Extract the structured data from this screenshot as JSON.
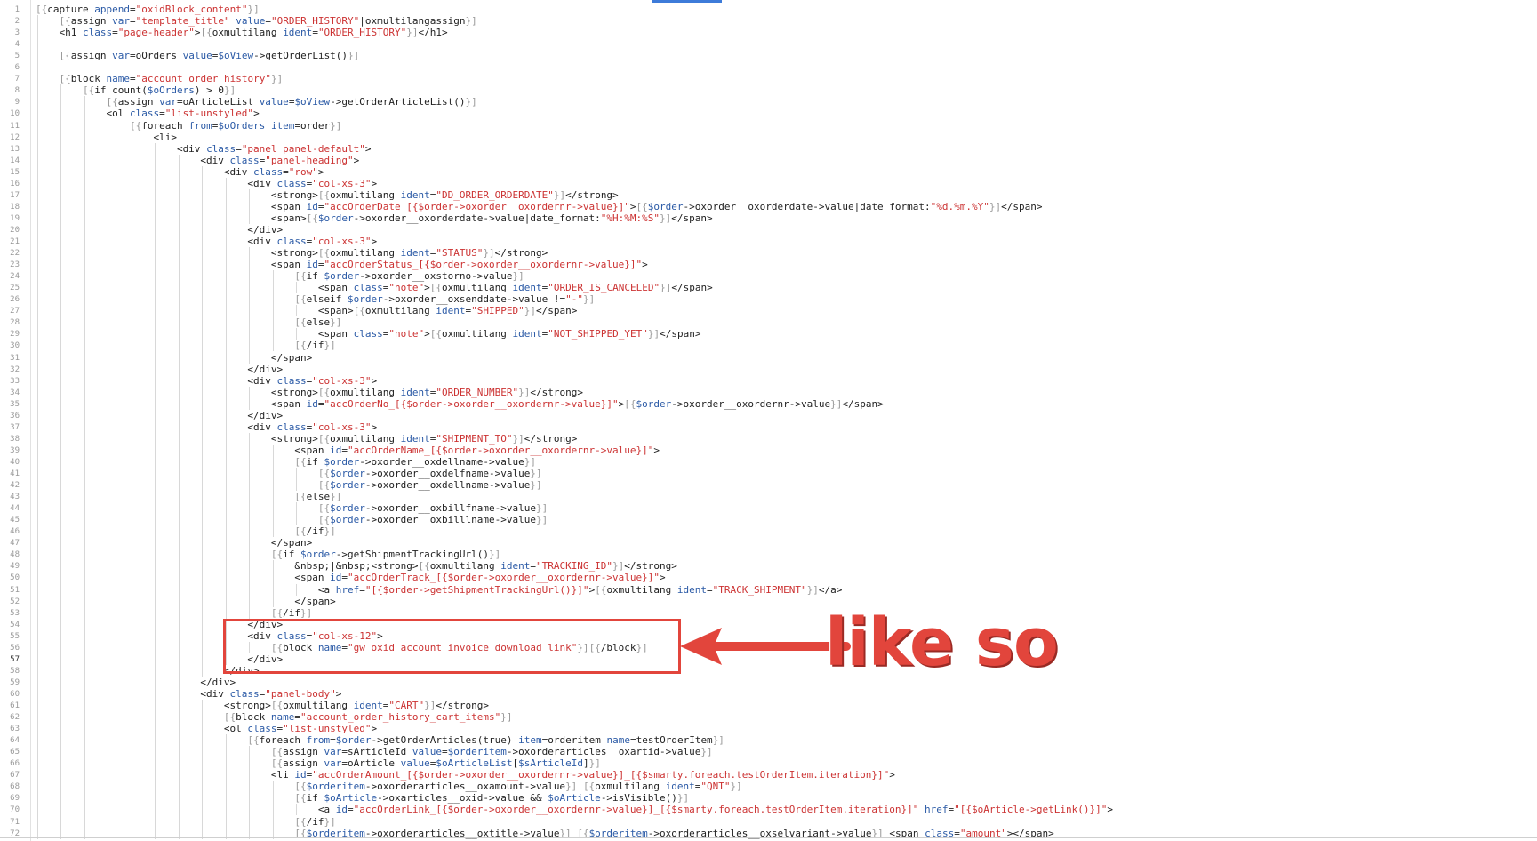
{
  "editor": {
    "lines": [
      "[{capture append=\"oxidBlock_content\"}]",
      "    [{assign var=\"template_title\" value=\"ORDER_HISTORY\"|oxmultilangassign}]",
      "    <h1 class=\"page-header\">[{oxmultilang ident=\"ORDER_HISTORY\"}]</h1>",
      "",
      "    [{assign var=oOrders value=$oView->getOrderList()}]",
      "",
      "    [{block name=\"account_order_history\"}]",
      "        [{if count($oOrders) > 0}]",
      "            [{assign var=oArticleList value=$oView->getOrderArticleList()}]",
      "            <ol class=\"list-unstyled\">",
      "                [{foreach from=$oOrders item=order}]",
      "                    <li>",
      "                        <div class=\"panel panel-default\">",
      "                            <div class=\"panel-heading\">",
      "                                <div class=\"row\">",
      "                                    <div class=\"col-xs-3\">",
      "                                        <strong>[{oxmultilang ident=\"DD_ORDER_ORDERDATE\"}]</strong>",
      "                                        <span id=\"accOrderDate_[{$order->oxorder__oxordernr->value}]\">[{$order->oxorder__oxorderdate->value|date_format:\"%d.%m.%Y\"}]</span>",
      "                                        <span>[{$order->oxorder__oxorderdate->value|date_format:\"%H:%M:%S\"}]</span>",
      "                                    </div>",
      "                                    <div class=\"col-xs-3\">",
      "                                        <strong>[{oxmultilang ident=\"STATUS\"}]</strong>",
      "                                        <span id=\"accOrderStatus_[{$order->oxorder__oxordernr->value}]\">",
      "                                            [{if $order->oxorder__oxstorno->value}]",
      "                                                <span class=\"note\">[{oxmultilang ident=\"ORDER_IS_CANCELED\"}]</span>",
      "                                            [{elseif $order->oxorder__oxsenddate->value !=\"-\"}]",
      "                                                <span>[{oxmultilang ident=\"SHIPPED\"}]</span>",
      "                                            [{else}]",
      "                                                <span class=\"note\">[{oxmultilang ident=\"NOT_SHIPPED_YET\"}]</span>",
      "                                            [{/if}]",
      "                                        </span>",
      "                                    </div>",
      "                                    <div class=\"col-xs-3\">",
      "                                        <strong>[{oxmultilang ident=\"ORDER_NUMBER\"}]</strong>",
      "                                        <span id=\"accOrderNo_[{$order->oxorder__oxordernr->value}]\">[{$order->oxorder__oxordernr->value}]</span>",
      "                                    </div>",
      "                                    <div class=\"col-xs-3\">",
      "                                        <strong>[{oxmultilang ident=\"SHIPMENT_TO\"}]</strong>",
      "                                            <span id=\"accOrderName_[{$order->oxorder__oxordernr->value}]\">",
      "                                            [{if $order->oxorder__oxdellname->value}]",
      "                                                [{$order->oxorder__oxdelfname->value}]",
      "                                                [{$order->oxorder__oxdellname->value}]",
      "                                            [{else}]",
      "                                                [{$order->oxorder__oxbillfname->value}]",
      "                                                [{$order->oxorder__oxbilllname->value}]",
      "                                            [{/if}]",
      "                                        </span>",
      "                                        [{if $order->getShipmentTrackingUrl()}]",
      "                                            &nbsp;|&nbsp;<strong>[{oxmultilang ident=\"TRACKING_ID\"}]</strong>",
      "                                            <span id=\"accOrderTrack_[{$order->oxorder__oxordernr->value}]\">",
      "                                                <a href=\"[{$order->getShipmentTrackingUrl()}]\">[{oxmultilang ident=\"TRACK_SHIPMENT\"}]</a>",
      "                                            </span>",
      "                                        [{/if}]",
      "                                    </div>",
      "                                    <div class=\"col-xs-12\">",
      "                                        [{block name=\"gw_oxid_account_invoice_download_link\"}][{/block}]",
      "                                    </div>",
      "                                </div>",
      "                            </div>",
      "                            <div class=\"panel-body\">",
      "                                <strong>[{oxmultilang ident=\"CART\"}]</strong>",
      "                                [{block name=\"account_order_history_cart_items\"}]",
      "                                <ol class=\"list-unstyled\">",
      "                                    [{foreach from=$order->getOrderArticles(true) item=orderitem name=testOrderItem}]",
      "                                        [{assign var=sArticleId value=$orderitem->oxorderarticles__oxartid->value}]",
      "                                        [{assign var=oArticle value=$oArticleList[$sArticleId]}]",
      "                                        <li id=\"accOrderAmount_[{$order->oxorder__oxordernr->value}]_[{$smarty.foreach.testOrderItem.iteration}]\">",
      "                                            [{$orderitem->oxorderarticles__oxamount->value}] [{oxmultilang ident=\"QNT\"}]",
      "                                            [{if $oArticle->oxarticles__oxid->value && $oArticle->isVisible()}]",
      "                                                <a id=\"accOrderLink_[{$order->oxorder__oxordernr->value}]_[{$smarty.foreach.testOrderItem.iteration}]\" href=\"[{$oArticle->getLink()}]\">",
      "                                            [{/if}]",
      "                                            [{$orderitem->oxorderarticles__oxtitle->value}] [{$orderitem->oxorderarticles__oxselvariant->value}] <span class=\"amount\"></span>"
    ],
    "current_line": 57,
    "colors": {
      "brace": "#9a9a9a",
      "keyword": "#2b5aa6",
      "string": "#cc3333",
      "text": "#222222",
      "callout": "#e2453c"
    }
  },
  "annotation": {
    "label": "like so",
    "arrow_icon": "left-arrow-icon"
  }
}
